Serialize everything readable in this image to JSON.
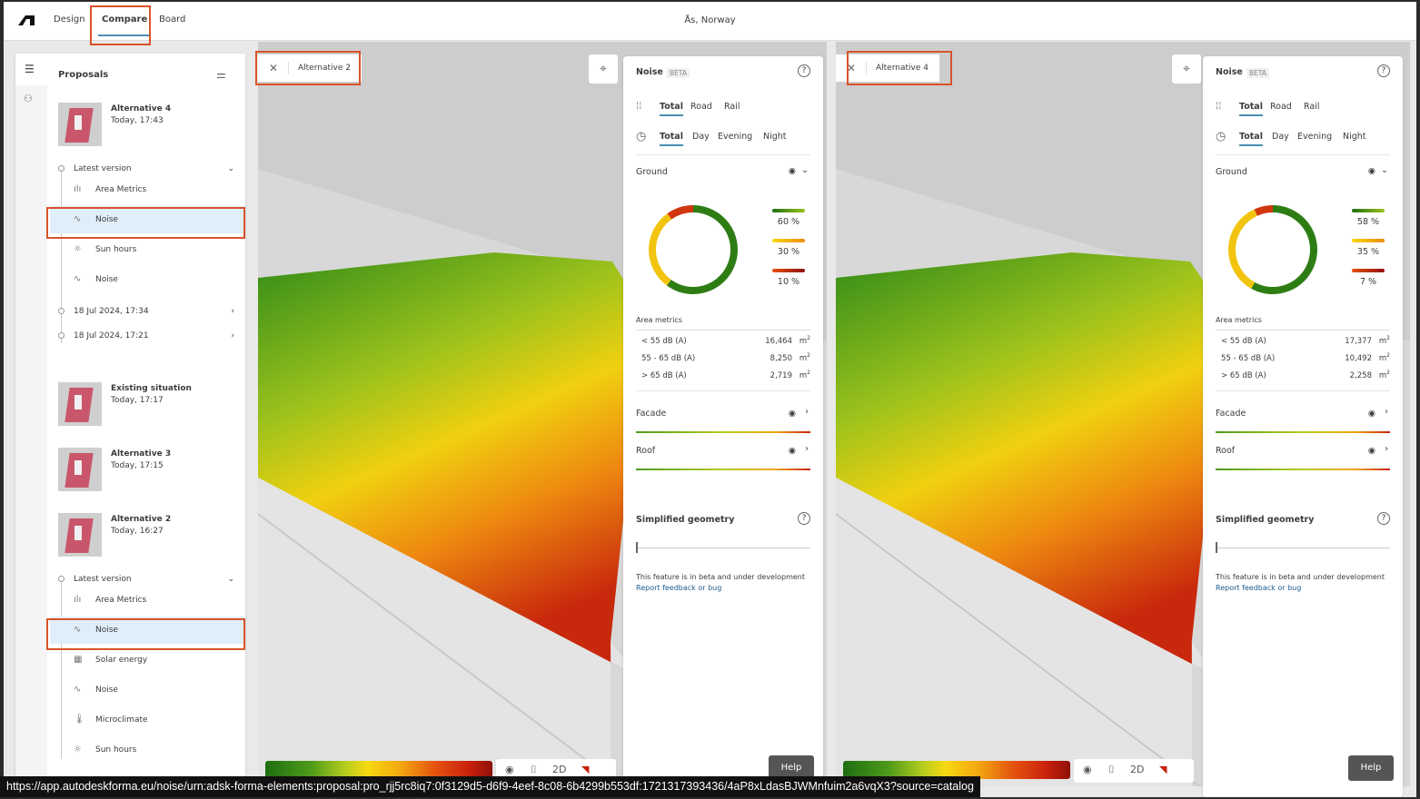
{
  "topbar": {
    "tabs": [
      {
        "label": "Design"
      },
      {
        "label": "Compare",
        "active": true
      },
      {
        "label": "Board"
      }
    ],
    "location": "Ås, Norway"
  },
  "sidebar": {
    "title": "Proposals",
    "proposals": [
      {
        "name": "Alternative 4",
        "time": "Today, 17:43"
      },
      {
        "name": "Existing situation",
        "time": "Today, 17:17"
      },
      {
        "name": "Alternative 3",
        "time": "Today, 17:15"
      },
      {
        "name": "Alternative 2",
        "time": "Today, 16:27"
      }
    ],
    "alt4_versions": {
      "latest": "Latest version",
      "items": [
        {
          "icon": "bar-chart-icon",
          "label": "Area Metrics"
        },
        {
          "icon": "waveform-icon",
          "label": "Noise",
          "selected": true
        },
        {
          "icon": "sun-icon",
          "label": "Sun hours"
        },
        {
          "icon": "waveform-icon",
          "label": "Noise"
        }
      ],
      "older": [
        "18 Jul 2024, 17:34",
        "18 Jul 2024, 17:21"
      ]
    },
    "alt2_versions": {
      "latest": "Latest version",
      "items": [
        {
          "icon": "bar-chart-icon",
          "label": "Area Metrics"
        },
        {
          "icon": "waveform-icon",
          "label": "Noise",
          "selected": true
        },
        {
          "icon": "solar-panel-icon",
          "label": "Solar energy"
        },
        {
          "icon": "waveform-icon",
          "label": "Noise"
        },
        {
          "icon": "thermometer-icon",
          "label": "Microclimate"
        },
        {
          "icon": "sun-icon",
          "label": "Sun hours"
        }
      ]
    }
  },
  "views": [
    {
      "proposal": "Alternative 2",
      "noise": {
        "title": "Noise",
        "badge": "BETA",
        "source_tabs": [
          "Total",
          "Road",
          "Rail"
        ],
        "time_tabs": [
          "Total",
          "Day",
          "Evening",
          "Night"
        ],
        "ground": "Ground",
        "shares": [
          {
            "pct": 60,
            "label": "60 %",
            "color": "#2e7d14"
          },
          {
            "pct": 30,
            "label": "30 %",
            "color": "#f2c40f"
          },
          {
            "pct": 10,
            "label": "10 %",
            "color": "#d2360f"
          }
        ],
        "area_title": "Area metrics",
        "area": [
          {
            "range": "< 55 dB (A)",
            "value": "16,464"
          },
          {
            "range": "55 - 65 dB (A)",
            "value": "8,250"
          },
          {
            "range": "> 65 dB (A)",
            "value": "2,719"
          }
        ],
        "unit": "m²",
        "facade": "Facade",
        "roof": "Roof",
        "simplified": "Simplified geometry",
        "simplified_level": 0,
        "beta_note": "This feature is in beta and under development",
        "feedback": "Report feedback or bug",
        "help": "Help"
      }
    },
    {
      "proposal": "Alternative 4",
      "noise": {
        "title": "Noise",
        "badge": "BETA",
        "source_tabs": [
          "Total",
          "Road",
          "Rail"
        ],
        "time_tabs": [
          "Total",
          "Day",
          "Evening",
          "Night"
        ],
        "ground": "Ground",
        "shares": [
          {
            "pct": 58,
            "label": "58 %",
            "color": "#2e7d14"
          },
          {
            "pct": 35,
            "label": "35 %",
            "color": "#f2c40f"
          },
          {
            "pct": 7,
            "label": "7 %",
            "color": "#d2360f"
          }
        ],
        "area_title": "Area metrics",
        "area": [
          {
            "range": "< 55 dB (A)",
            "value": "17,377"
          },
          {
            "range": "55 - 65 dB (A)",
            "value": "10,492"
          },
          {
            "range": "> 65 dB (A)",
            "value": "2,258"
          }
        ],
        "unit": "m²",
        "facade": "Facade",
        "roof": "Roof",
        "simplified": "Simplified geometry",
        "simplified_level": 0,
        "beta_note": "This feature is in beta and under development",
        "feedback": "Report feedback or bug",
        "help": "Help"
      }
    }
  ],
  "view_tools": {
    "mode": "2D"
  },
  "status_url": "https://app.autodeskforma.eu/noise/urn:adsk-forma-elements:proposal:pro_rjj5rc8iq7:0f3129d5-d6f9-4eef-8c08-6b4299b553df:1721317393436/4aP8xLdasBJWMnfuim2a6vqX3?source=catalog"
}
